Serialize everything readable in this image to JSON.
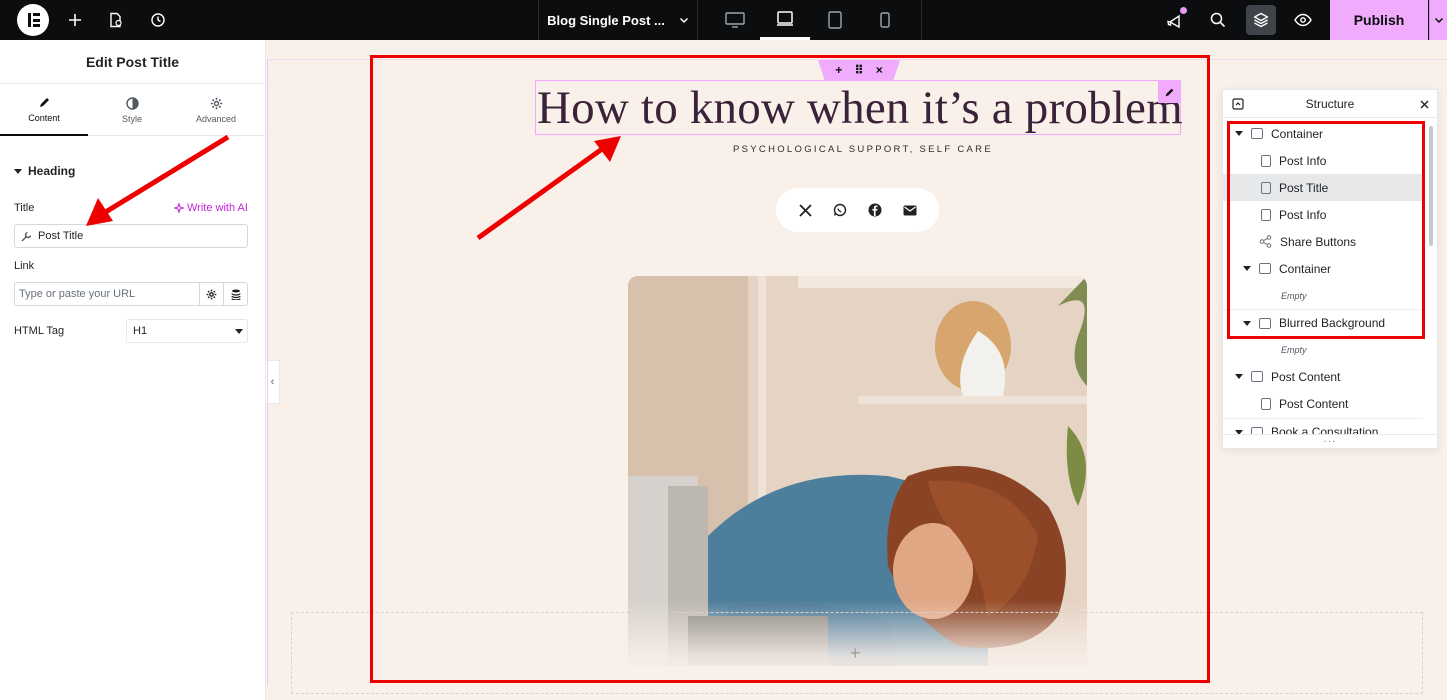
{
  "colors": {
    "accent": "#f0abfc",
    "topbar": "#0c0d0e",
    "canvas_bg": "#f9f0ea",
    "annotation_red": "#ef0000",
    "ai_link": "#c026d3"
  },
  "topbar": {
    "document_title": "Blog Single Post ...",
    "publish_label": "Publish",
    "icons": [
      "elementor-logo",
      "add-icon",
      "page-settings-icon",
      "history-icon",
      "chevron-down-icon",
      "desktop-icon",
      "laptop-icon",
      "tablet-icon",
      "mobile-icon",
      "notifications-icon",
      "search-icon",
      "layers-icon",
      "preview-eye-icon"
    ]
  },
  "panel": {
    "title": "Edit Post Title",
    "tabs": [
      {
        "label": "Content",
        "icon": "pencil-icon",
        "active": true
      },
      {
        "label": "Style",
        "icon": "half-circle-icon",
        "active": false
      },
      {
        "label": "Advanced",
        "icon": "gear-icon",
        "active": false
      }
    ],
    "section": "Heading",
    "title_label": "Title",
    "ai_label": "Write with AI",
    "title_value": "Post Title",
    "link_label": "Link",
    "link_placeholder": "Type or paste your URL",
    "html_tag_label": "HTML Tag",
    "html_tag_value": "H1"
  },
  "canvas": {
    "heading": "How to know when it’s a problem",
    "subtitle": "PSYCHOLOGICAL SUPPORT, SELF CARE",
    "share_icons": [
      "x-twitter-icon",
      "whatsapp-icon",
      "facebook-icon",
      "email-icon"
    ]
  },
  "structure": {
    "title": "Structure",
    "items": [
      {
        "label": "Container",
        "level": 0,
        "kind": "container",
        "expanded": true
      },
      {
        "label": "Post Info",
        "level": 1,
        "kind": "widget"
      },
      {
        "label": "Post Title",
        "level": 1,
        "kind": "widget",
        "selected": true
      },
      {
        "label": "Post Info",
        "level": 1,
        "kind": "widget"
      },
      {
        "label": "Share Buttons",
        "level": 1,
        "kind": "share"
      },
      {
        "label": "Container",
        "level": 1,
        "kind": "container",
        "expanded": true
      },
      {
        "label": "Empty",
        "level": 2,
        "kind": "empty"
      },
      {
        "label": "Blurred Background",
        "level": 1,
        "kind": "container",
        "expanded": true
      },
      {
        "label": "Empty",
        "level": 2,
        "kind": "empty"
      },
      {
        "label": "Post Content",
        "level": 0,
        "kind": "container",
        "expanded": true
      },
      {
        "label": "Post Content",
        "level": 1,
        "kind": "widget"
      },
      {
        "label": "Book a Consultation",
        "level": 0,
        "kind": "container",
        "expanded": true
      }
    ]
  }
}
